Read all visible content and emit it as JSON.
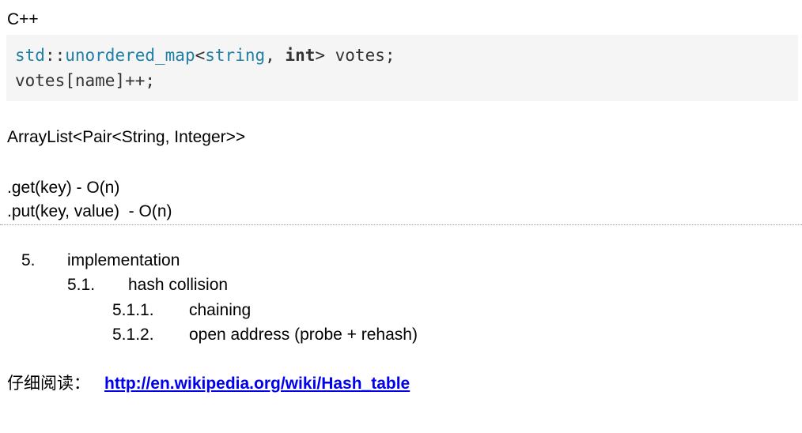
{
  "heading_language": "C++",
  "code": {
    "line1": {
      "ns": "std",
      "sep": "::",
      "type": "unordered_map",
      "lt": "<",
      "t1": "string",
      "comma": ", ",
      "t2": "int",
      "rest": "> votes;"
    },
    "line2": "votes[name]++;"
  },
  "java_type": "ArrayList<Pair<String, Integer>>",
  "complexity": [
    ".get(key) - O(n)",
    ".put(key, value)  - O(n)"
  ],
  "outline": {
    "item5": {
      "num": "5.",
      "label": "implementation"
    },
    "item51": {
      "num": "5.1.",
      "label": "hash collision"
    },
    "item511": {
      "num": "5.1.1.",
      "label": "chaining"
    },
    "item512": {
      "num": "5.1.2.",
      "label": "open address (probe + rehash)"
    }
  },
  "reading": {
    "label": "仔细阅读：",
    "link": "http://en.wikipedia.org/wiki/Hash_table"
  }
}
